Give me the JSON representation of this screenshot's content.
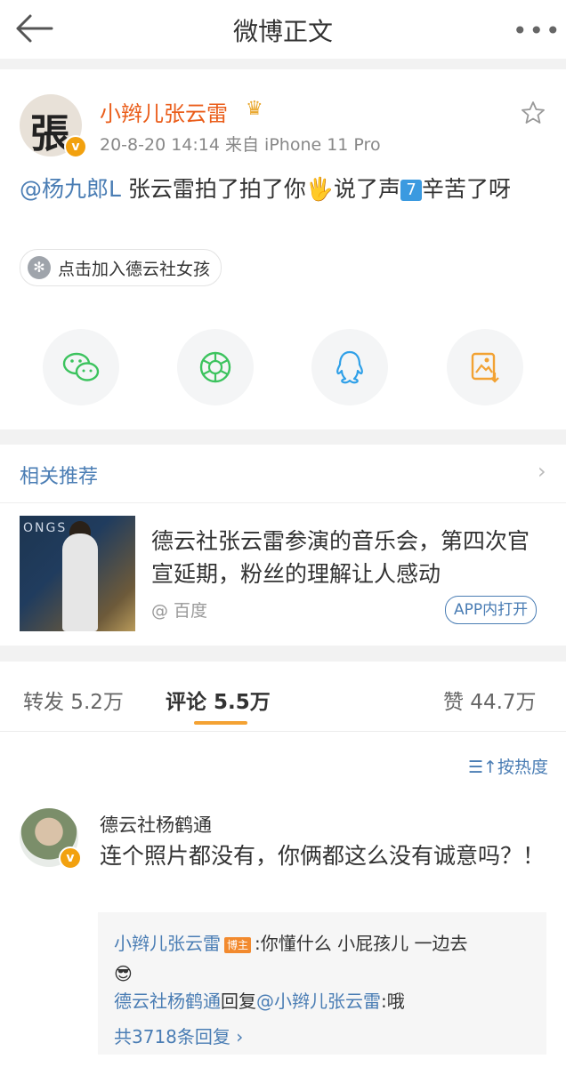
{
  "header": {
    "title": "微博正文",
    "more": "•••"
  },
  "post": {
    "avatar_char": "張",
    "username": "小辫儿张云雷",
    "crown": "♛",
    "time": "20-8-20 14:14",
    "source": "来自 iPhone 11 Pro",
    "mention": "@杨九郎L",
    "text_a": " 张云雷拍了拍了你",
    "emoji_hand": "🖐",
    "text_b": "说了声",
    "emoji_seven": "7",
    "text_c": "辛苦了呀",
    "tag_label": "点击加入德云社女孩"
  },
  "share_icons": [
    "wechat-icon",
    "moments-icon",
    "qq-icon",
    "save-image-icon"
  ],
  "recommend": {
    "title": "相关推荐",
    "arrow": "›",
    "thumb_text": "ONGS",
    "article": "德云社张云雷参演的音乐会，第四次官宣延期，粉丝的理解让人感动",
    "source": "@ 百度",
    "button": "APP内打开"
  },
  "tabs": {
    "repost": "转发 5.2万",
    "comment": "评论 5.5万",
    "like": "赞 44.7万",
    "accent": "#f4a233"
  },
  "comments": {
    "sort_label": "按热度",
    "name": "德云社杨鹤通",
    "text": "连个照片都没有，你俩都这么没有诚意吗？！",
    "reply1_user": "小辫儿张云雷",
    "reply1_badge": "博主",
    "reply1_text": ":你懂什么 小屁孩儿 一边去",
    "reply1_emoji": "😎",
    "reply2_user": "德云社杨鹤通",
    "reply2_mid": "回复",
    "reply2_target": "@小辫儿张云雷",
    "reply2_text": ":哦",
    "more_replies": "共3718条回复 ›"
  }
}
